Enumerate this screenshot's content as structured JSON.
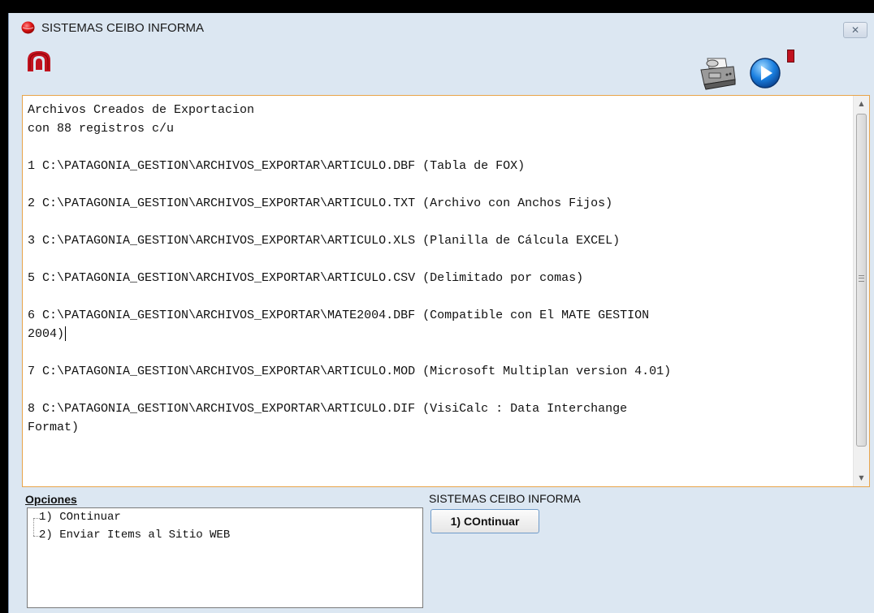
{
  "window": {
    "title": "SISTEMAS CEIBO INFORMA",
    "close_symbol": "✕",
    "icons": [
      "red-ball-icon",
      "ceibo-logo-icon",
      "printer-icon",
      "play-icon",
      "red-box-icon"
    ]
  },
  "main_text": {
    "lines": [
      "Archivos Creados de Exportacion",
      "con 88 registros c/u",
      "",
      "1 C:\\PATAGONIA_GESTION\\ARCHIVOS_EXPORTAR\\ARTICULO.DBF (Tabla de FOX)",
      "",
      "2 C:\\PATAGONIA_GESTION\\ARCHIVOS_EXPORTAR\\ARTICULO.TXT (Archivo con Anchos Fijos)",
      "",
      "3 C:\\PATAGONIA_GESTION\\ARCHIVOS_EXPORTAR\\ARTICULO.XLS (Planilla de Cálcula EXCEL)",
      "",
      "5 C:\\PATAGONIA_GESTION\\ARCHIVOS_EXPORTAR\\ARTICULO.CSV (Delimitado por comas)",
      "",
      "6 C:\\PATAGONIA_GESTION\\ARCHIVOS_EXPORTAR\\MATE2004.DBF (Compatible con El MATE GESTION",
      "2004)",
      "",
      "7 C:\\PATAGONIA_GESTION\\ARCHIVOS_EXPORTAR\\ARTICULO.MOD (Microsoft Multiplan version 4.01)",
      "",
      "8 C:\\PATAGONIA_GESTION\\ARCHIVOS_EXPORTAR\\ARTICULO.DIF (VisiCalc : Data Interchange",
      "Format)"
    ]
  },
  "options": {
    "label": "Opciones",
    "items": [
      {
        "label": "1) COntinuar"
      },
      {
        "label": "2) Enviar Items al Sitio WEB"
      }
    ]
  },
  "action_group": {
    "label": "SISTEMAS CEIBO INFORMA",
    "button_label": "1) COntinuar"
  },
  "colors": {
    "window_bg": "#dce7f2",
    "text_border": "#e8a44a",
    "button_border": "#6f9bc9",
    "logo_red": "#c1121f"
  }
}
